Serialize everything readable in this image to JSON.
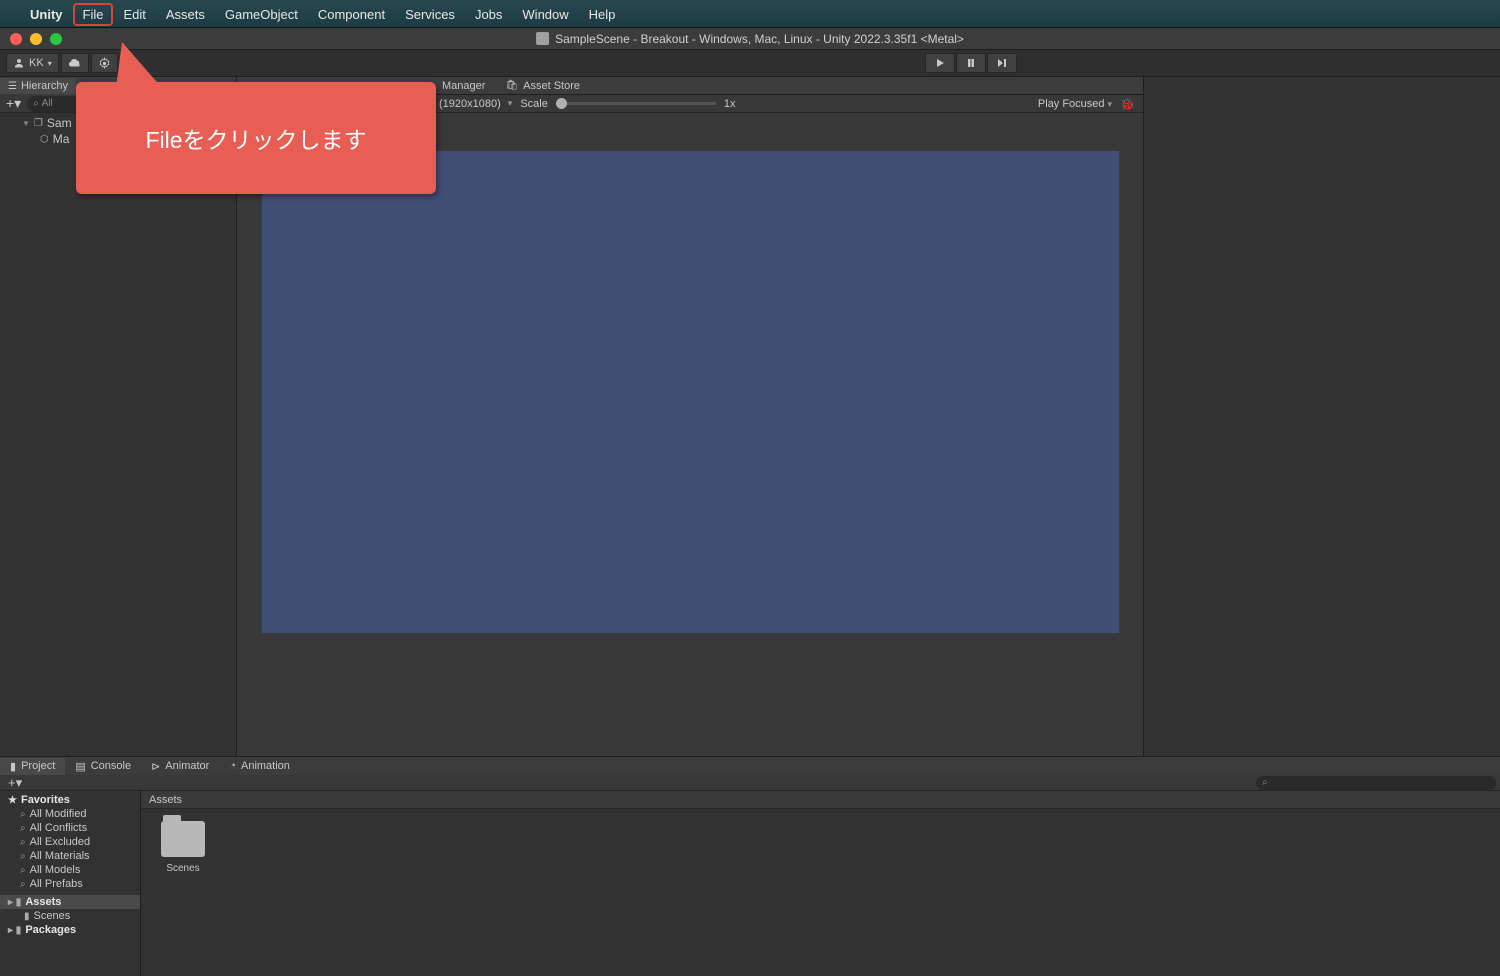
{
  "menubar": {
    "app": "Unity",
    "items": [
      "File",
      "Edit",
      "Assets",
      "GameObject",
      "Component",
      "Services",
      "Jobs",
      "Window",
      "Help"
    ],
    "highlighted": "File"
  },
  "window": {
    "title": "SampleScene - Breakout - Windows, Mac, Linux - Unity 2022.3.35f1 <Metal>"
  },
  "toolbar": {
    "account": "KK"
  },
  "hierarchy": {
    "tab": "Hierarchy",
    "search_placeholder": "All",
    "items": {
      "root": "Sam",
      "child": "Ma"
    }
  },
  "center_tabs": {
    "manager": "Manager",
    "store": "Asset Store"
  },
  "game_toolbar": {
    "resolution": "(1920x1080)",
    "scale_label": "Scale",
    "scale_value": "1x",
    "play_mode": "Play Focused"
  },
  "bottom_tabs": {
    "project": "Project",
    "console": "Console",
    "animator": "Animator",
    "animation": "Animation"
  },
  "project": {
    "favorites_header": "Favorites",
    "favorites": [
      "All Modified",
      "All Conflicts",
      "All Excluded",
      "All Materials",
      "All Models",
      "All Prefabs"
    ],
    "assets_header": "Assets",
    "assets_children": [
      "Scenes"
    ],
    "packages": "Packages",
    "breadcrumb": "Assets",
    "folder": "Scenes"
  },
  "callout": {
    "text": "Fileをクリックします"
  }
}
